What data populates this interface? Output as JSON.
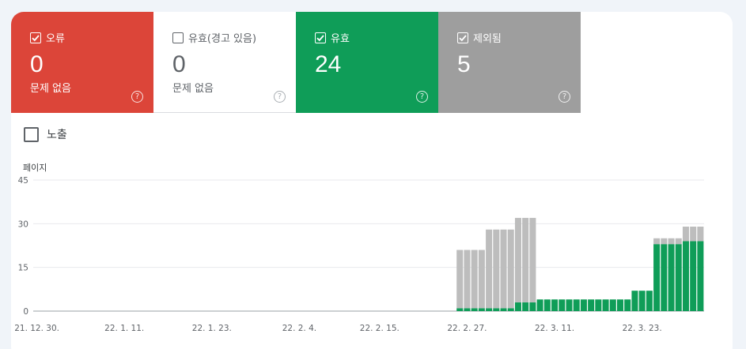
{
  "tiles": {
    "error": {
      "label": "오류",
      "count": "0",
      "sub": "문제 없음",
      "checked": true
    },
    "warning": {
      "label": "유효(경고 있음)",
      "count": "0",
      "sub": "문제 없음",
      "checked": false
    },
    "valid": {
      "label": "유효",
      "count": "24",
      "checked": true
    },
    "excluded": {
      "label": "제외됨",
      "count": "5",
      "checked": true
    }
  },
  "impressions": {
    "label": "노출"
  },
  "colors": {
    "error": "#dc4539",
    "valid": "#0f9d58",
    "excluded": "#bdbdbd",
    "excluded_tile": "#9e9e9e"
  },
  "chart_data": {
    "type": "bar",
    "stacked": true,
    "ylabel": "페이지",
    "yticks": [
      0,
      15,
      30,
      45
    ],
    "ylim": [
      0,
      45
    ],
    "x_tick_labels": [
      "21. 12. 30.",
      "22. 1. 11.",
      "22. 1. 23.",
      "22. 2. 4.",
      "22. 2. 15.",
      "22. 2. 27.",
      "22. 3. 11.",
      "22. 3. 23."
    ],
    "x_tick_days": [
      0,
      12,
      24,
      36,
      47,
      59,
      71,
      83
    ],
    "days_total": 92,
    "series": [
      {
        "key": "valid",
        "values": [
          0,
          0,
          0,
          0,
          0,
          0,
          0,
          0,
          0,
          0,
          0,
          0,
          0,
          0,
          0,
          0,
          0,
          0,
          0,
          0,
          0,
          0,
          0,
          0,
          0,
          0,
          0,
          0,
          0,
          0,
          0,
          0,
          0,
          0,
          0,
          0,
          0,
          0,
          0,
          0,
          0,
          0,
          0,
          0,
          0,
          0,
          0,
          0,
          0,
          0,
          0,
          0,
          0,
          0,
          0,
          0,
          0,
          0,
          1,
          1,
          1,
          1,
          1,
          1,
          1,
          1,
          3,
          3,
          3,
          4,
          4,
          4,
          4,
          4,
          4,
          4,
          4,
          4,
          4,
          4,
          4,
          4,
          7,
          7,
          7,
          23,
          23,
          23,
          23,
          24,
          24,
          24
        ]
      },
      {
        "key": "excluded",
        "values": [
          0,
          0,
          0,
          0,
          0,
          0,
          0,
          0,
          0,
          0,
          0,
          0,
          0,
          0,
          0,
          0,
          0,
          0,
          0,
          0,
          0,
          0,
          0,
          0,
          0,
          0,
          0,
          0,
          0,
          0,
          0,
          0,
          0,
          0,
          0,
          0,
          0,
          0,
          0,
          0,
          0,
          0,
          0,
          0,
          0,
          0,
          0,
          0,
          0,
          0,
          0,
          0,
          0,
          0,
          0,
          0,
          0,
          0,
          20,
          20,
          20,
          20,
          27,
          27,
          27,
          27,
          29,
          29,
          29,
          0,
          0,
          0,
          0,
          0,
          0,
          0,
          0,
          0,
          0,
          0,
          0,
          0,
          0,
          0,
          0,
          2,
          2,
          2,
          2,
          5,
          5,
          5
        ]
      }
    ],
    "grid": true
  }
}
